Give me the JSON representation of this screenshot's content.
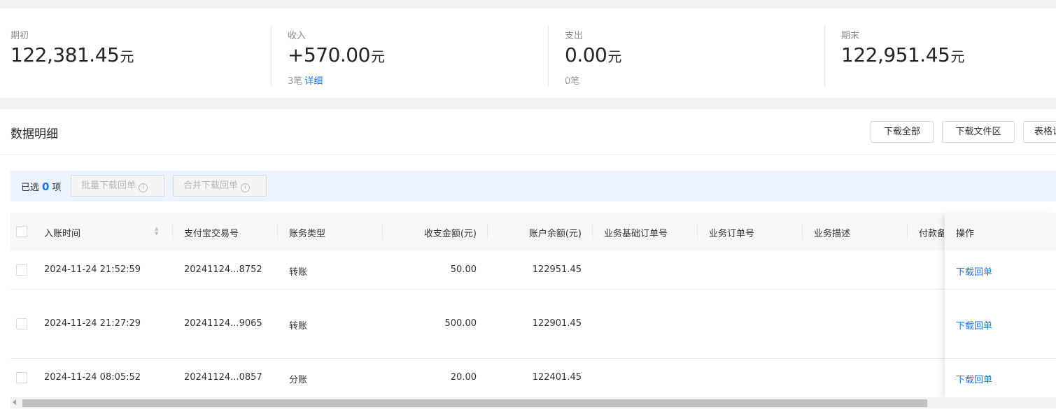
{
  "summary": {
    "opening": {
      "label": "期初",
      "amount": "122,381.45",
      "unit": "元"
    },
    "income": {
      "label": "收入",
      "amount": "+570.00",
      "unit": "元",
      "count": "3笔",
      "link": "详细"
    },
    "expense": {
      "label": "支出",
      "amount": "0.00",
      "unit": "元",
      "count": "0笔"
    },
    "closing": {
      "label": "期末",
      "amount": "122,951.45",
      "unit": "元"
    }
  },
  "detail": {
    "title": "数据明细",
    "buttons": {
      "download_all": "下载全部",
      "download_folder": "下载文件区",
      "table_settings": "表格设置"
    },
    "selection": {
      "prefix": "已选",
      "count": "0",
      "suffix": "项",
      "batch_download": "批量下载回单",
      "merge_download": "合并下载回单"
    }
  },
  "table": {
    "headers": {
      "time": "入账时间",
      "trade_no": "支付宝交易号",
      "type": "账务类型",
      "amount": "收支金额(元)",
      "balance": "账户余额(元)",
      "base_order": "业务基础订单号",
      "order": "业务订单号",
      "desc": "业务描述",
      "remark": "付款备注",
      "action": "操作"
    },
    "rows": [
      {
        "time": "2024-11-24 21:52:59",
        "trade_no": "20241124...8752",
        "type": "转账",
        "amount": "50.00",
        "balance": "122951.45",
        "action": "下载回单"
      },
      {
        "time": "2024-11-24 21:27:29",
        "trade_no": "20241124...9065",
        "type": "转账",
        "amount": "500.00",
        "balance": "122901.45",
        "action": "下载回单"
      },
      {
        "time": "2024-11-24 08:05:52",
        "trade_no": "20241124...0857",
        "type": "分账",
        "amount": "20.00",
        "balance": "122401.45",
        "action": "下载回单"
      }
    ]
  },
  "colors": {
    "accent": "#1677ff",
    "selection_bg": "#eaf3ff"
  }
}
